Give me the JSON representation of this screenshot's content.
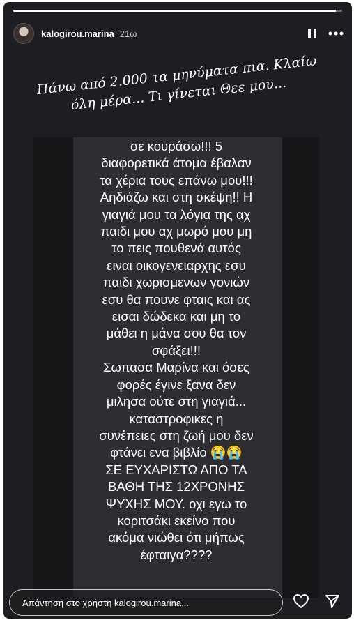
{
  "story": {
    "progress": 0.98,
    "user": {
      "username": "kalogirou.marina",
      "time": "21ω"
    },
    "caption": "Πάνω από 2.000 τα μηνύματα πια. Κλαίω όλη μέρα... Τι γίνεται Θεε μου...",
    "message": "σε κουράσω!!! 5\nδιαφορετικά άτομα έβαλαν\nτα χέρια τους επάνω μου!!!\nΑηδιάζω και στη σκέψη!! Η\nγιαγιά μου τα λόγια της αχ\nπαιδι μου αχ μωρό μου μη\nτο πεις πουθενά αυτός\nειναι οικογενειαρχης εσυ\nπαιδι χωρισμενων γονιών\nεσυ θα πουνε φταις και ας\nεισαι δώδεκα και μη το\nμάθει η μάνα σου θα τον\nσφάξει!!!\nΣωπασα Μαρίνα και όσες\nφορές έγινε ξανα δεν\nμιλησα ούτε στη γιαγιά...\nκαταστροφικες η\nσυνέπειες στη ζωή μου δεν\nφτάνει ενα βιβλίο 😭😭\nΣΕ ΕΥΧΑΡΙΣΤΩ ΑΠΟ ΤΑ\nΒΑΘΗ ΤΗΣ 12ΧΡΟΝΗΣ\nΨΥΧΗΣ ΜΟΥ.  οχι εγω το\nκοριτσάκι εκείνο που\nακόμα νιώθει ότι μήπως\nέφταιγα????",
    "reply_placeholder": "Απάντηση στο χρήστη kalogirou.marina...",
    "icons": {
      "pause": "pause-icon",
      "more": "more-icon",
      "like": "heart-icon",
      "share": "send-icon"
    },
    "colors": {
      "background": "#1e1e22",
      "card": "#2d2e32",
      "text": "#ffffff"
    }
  }
}
